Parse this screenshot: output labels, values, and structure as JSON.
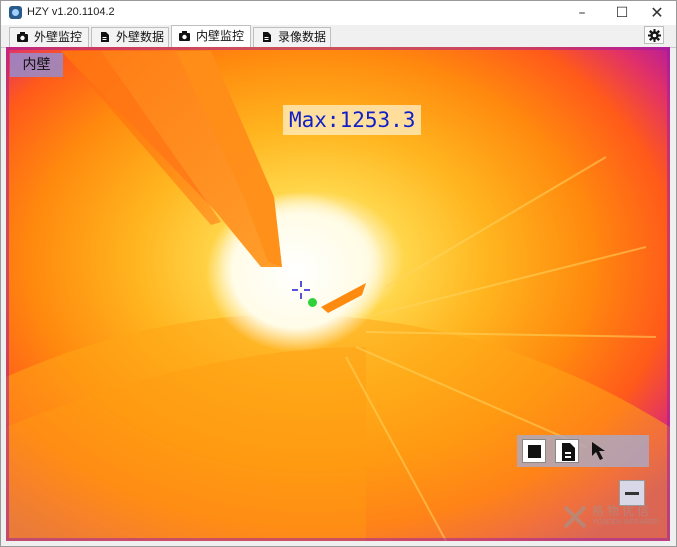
{
  "window": {
    "title": "HZY v1.20.1104.2"
  },
  "tabs": [
    {
      "label": "外壁监控",
      "icon": "camera-icon",
      "active": false
    },
    {
      "label": "外壁数据",
      "icon": "document-icon",
      "active": false
    },
    {
      "label": "内壁监控",
      "icon": "camera-icon",
      "active": true
    },
    {
      "label": "录像数据",
      "icon": "document-icon",
      "active": false
    }
  ],
  "view": {
    "label": "内壁",
    "max_readout": "Max:1253.3",
    "toolbar": [
      "stop-icon",
      "save-file-icon",
      "pointer-icon"
    ],
    "watermark": {
      "cn": "格物优信",
      "en": "YOSEEN INFRARED"
    }
  },
  "colors": {
    "hot": "#ffffff",
    "warm": "#ffb51f",
    "mid": "#ff7a0a",
    "cool": "#c0209a",
    "readout_text": "#1020c8",
    "hot_dot": "#2fd23a"
  }
}
